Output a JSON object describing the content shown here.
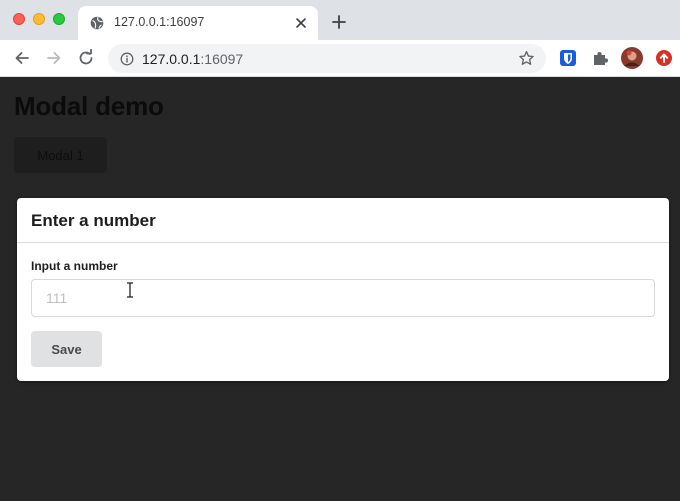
{
  "browser": {
    "tab_title": "127.0.0.1:16097",
    "url_host": "127.0.0.1",
    "url_port": ":16097"
  },
  "page": {
    "title": "Modal demo",
    "open_modal_button": "Modal 1"
  },
  "modal": {
    "title": "Enter a number",
    "field_label": "Input a number",
    "input_placeholder": "111",
    "input_value": "",
    "save_label": "Save"
  },
  "colors": {
    "overlay": "#262626",
    "modal_bg": "#ffffff",
    "save_button_bg": "#e0e1e2"
  }
}
